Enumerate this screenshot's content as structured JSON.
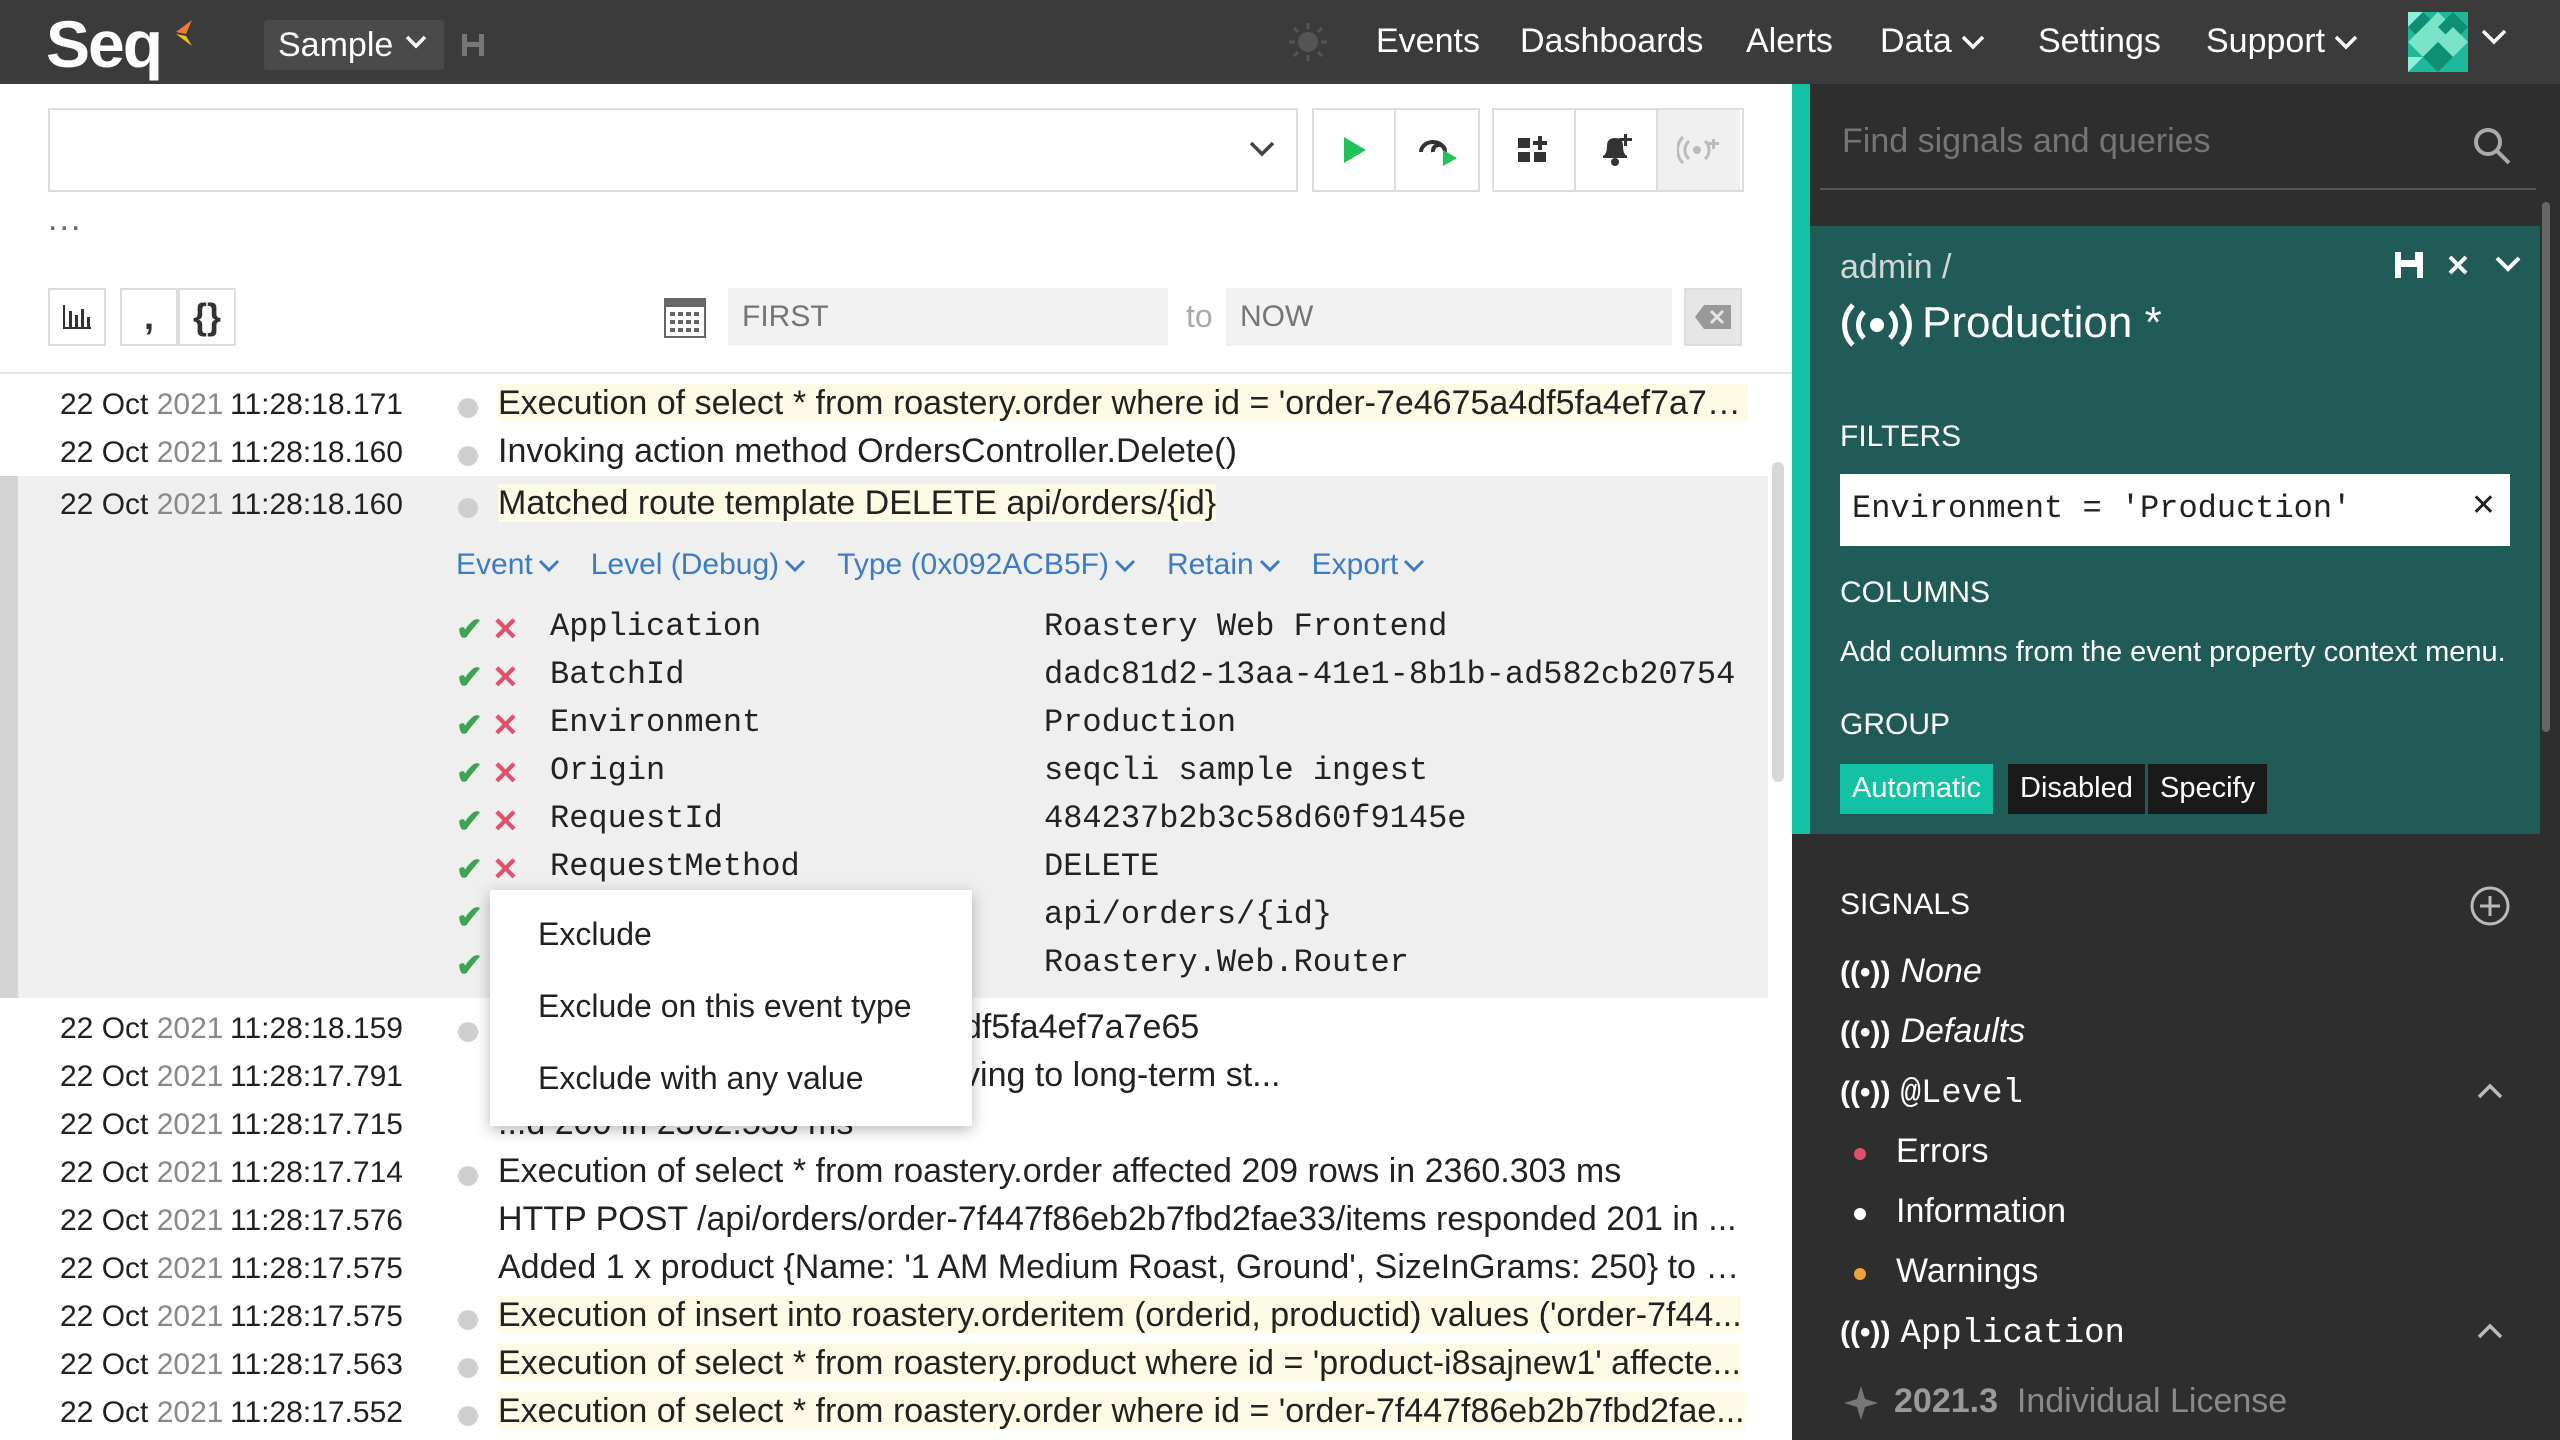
{
  "topbar": {
    "logo": "Seq",
    "workspace": "Sample",
    "nav": [
      {
        "label": "Events",
        "dropdown": false
      },
      {
        "label": "Dashboards",
        "dropdown": false
      },
      {
        "label": "Alerts",
        "dropdown": false
      },
      {
        "label": "Data",
        "dropdown": true
      },
      {
        "label": "Settings",
        "dropdown": false
      },
      {
        "label": "Support",
        "dropdown": true
      }
    ]
  },
  "search": {
    "query_value": "",
    "more": "..."
  },
  "toolbar": {
    "run_icon": "play-icon",
    "tail_icon": "refresh-play-icon",
    "add_to_dashboard_icon": "add-chart-icon",
    "add_alert_icon": "add-bell-icon",
    "signal_icon": "broadcast-icon"
  },
  "range": {
    "from_placeholder": "FIRST",
    "to_label": "to",
    "to_placeholder": "NOW"
  },
  "events_before": [
    {
      "date": "22 Oct",
      "year": "2021",
      "time": "11:28:18.171",
      "dot": true,
      "message": "Execution of select * from roastery.order where id = 'order-7e4675a4df5fa4ef7a7e...",
      "highlight": "hl"
    },
    {
      "date": "22 Oct",
      "year": "2021",
      "time": "11:28:18.160",
      "dot": true,
      "message": "Invoking action method OrdersController.Delete()",
      "highlight": ""
    }
  ],
  "expanded_event": {
    "date": "22 Oct",
    "year": "2021",
    "time": "11:28:18.160",
    "message": "Matched route template DELETE api/orders/{id}",
    "actions": [
      "Event",
      "Level (Debug)",
      "Type (0x092ACB5F)",
      "Retain",
      "Export"
    ],
    "properties": [
      {
        "name": "Application",
        "value": "Roastery Web Frontend"
      },
      {
        "name": "BatchId",
        "value": "dadc81d2-13aa-41e1-8b1b-ad582cb20754"
      },
      {
        "name": "Environment",
        "value": "Production"
      },
      {
        "name": "Origin",
        "value": "seqcli sample ingest"
      },
      {
        "name": "RequestId",
        "value": "484237b2b3c58d60f9145e"
      },
      {
        "name": "RequestMethod",
        "value": "DELETE"
      },
      {
        "name": "",
        "value": "api/orders/{id}"
      },
      {
        "name": "",
        "value": "Roastery.Web.Router"
      }
    ]
  },
  "context_menu": [
    "Exclude",
    "Exclude on this event type",
    "Exclude with any value"
  ],
  "events_after": [
    {
      "date": "22 Oct",
      "year": "2021",
      "time": "11:28:18.159",
      "dot": true,
      "message": "TE /api/orders/order-7e4675a4df5fa4ef7a7e65",
      "highlight": ""
    },
    {
      "date": "22 Oct",
      "year": "2021",
      "time": "11:28:17.791",
      "dot": false,
      "message": "a7e65 has been shipped; archiving to long-term st...",
      "highlight": ""
    },
    {
      "date": "22 Oct",
      "year": "2021",
      "time": "11:28:17.715",
      "dot": false,
      "message": "...d 200 in 2362.538 ms",
      "highlight": ""
    },
    {
      "date": "22 Oct",
      "year": "2021",
      "time": "11:28:17.714",
      "dot": true,
      "message": "Execution of select * from roastery.order affected 209 rows in 2360.303 ms",
      "highlight": ""
    },
    {
      "date": "22 Oct",
      "year": "2021",
      "time": "11:28:17.576",
      "dot": false,
      "message": "HTTP POST /api/orders/order-7f447f86eb2b7fbd2fae33/items responded 201 in ...",
      "highlight": ""
    },
    {
      "date": "22 Oct",
      "year": "2021",
      "time": "11:28:17.575",
      "dot": false,
      "message": "Added 1 x product {Name: '1 AM Medium Roast, Ground', SizeInGrams: 250} to or...",
      "highlight": ""
    },
    {
      "date": "22 Oct",
      "year": "2021",
      "time": "11:28:17.575",
      "dot": true,
      "message": "Execution of insert into roastery.orderitem (orderid, productid) values ('order-7f44...",
      "highlight": "hl"
    },
    {
      "date": "22 Oct",
      "year": "2021",
      "time": "11:28:17.563",
      "dot": true,
      "message": "Execution of select * from roastery.product where id = 'product-i8sajnew1' affecte...",
      "highlight": "hl"
    },
    {
      "date": "22 Oct",
      "year": "2021",
      "time": "11:28:17.552",
      "dot": true,
      "message": "Execution of select * from roastery.order where id = 'order-7f447f86eb2b7fbd2fae...",
      "highlight": "hl"
    }
  ],
  "right_panel": {
    "search_placeholder": "Find signals and queries",
    "signal": {
      "breadcrumb": "admin /",
      "title": "Production *",
      "filters_label": "FILTERS",
      "filter": "Environment = 'Production'",
      "columns_label": "COLUMNS",
      "columns_help": "Add columns from the event property context menu.",
      "group_label": "GROUP",
      "group_options": [
        "Automatic",
        "Disabled",
        "Specify"
      ],
      "group_selected": "Automatic"
    },
    "signals_label": "SIGNALS",
    "signals": [
      {
        "label": "None",
        "style": "italic"
      },
      {
        "label": "Defaults",
        "style": "italic"
      },
      {
        "label": "@Level",
        "style": "mono"
      }
    ],
    "level_items": [
      {
        "label": "Errors",
        "color": "#e0506a"
      },
      {
        "label": "Information",
        "color": "#ffffff"
      },
      {
        "label": "Warnings",
        "color": "#f0a03c"
      }
    ],
    "application_signal": "Application",
    "version": "2021.3",
    "license": "Individual License"
  },
  "colors": {
    "accent": "#13c2a4",
    "panel": "#205b58",
    "topbar": "#3b3b3c",
    "link": "#3c7cc6"
  }
}
